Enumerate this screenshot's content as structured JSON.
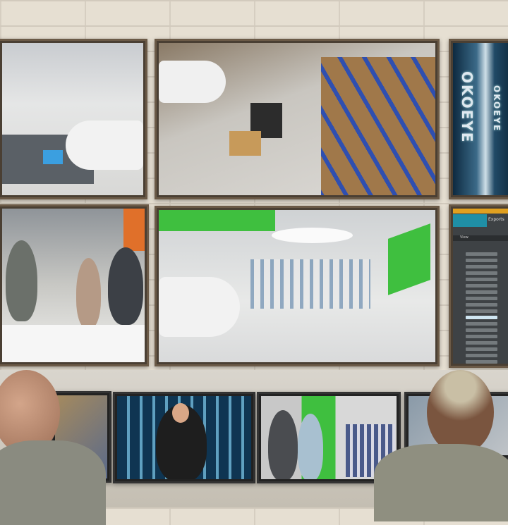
{
  "brand": {
    "logo_text": "OKOEYE"
  },
  "vms_panel": {
    "tabs": [
      "",
      "Exports"
    ],
    "view_label": "View",
    "header_color": "#e0a020",
    "tab_active_color": "#1f8fa6"
  },
  "colors": {
    "wall": "#e6dfd2",
    "bezel": "#4a3f33",
    "store_green": "#3fbf3f",
    "rack_blue": "#2f4fb0"
  }
}
